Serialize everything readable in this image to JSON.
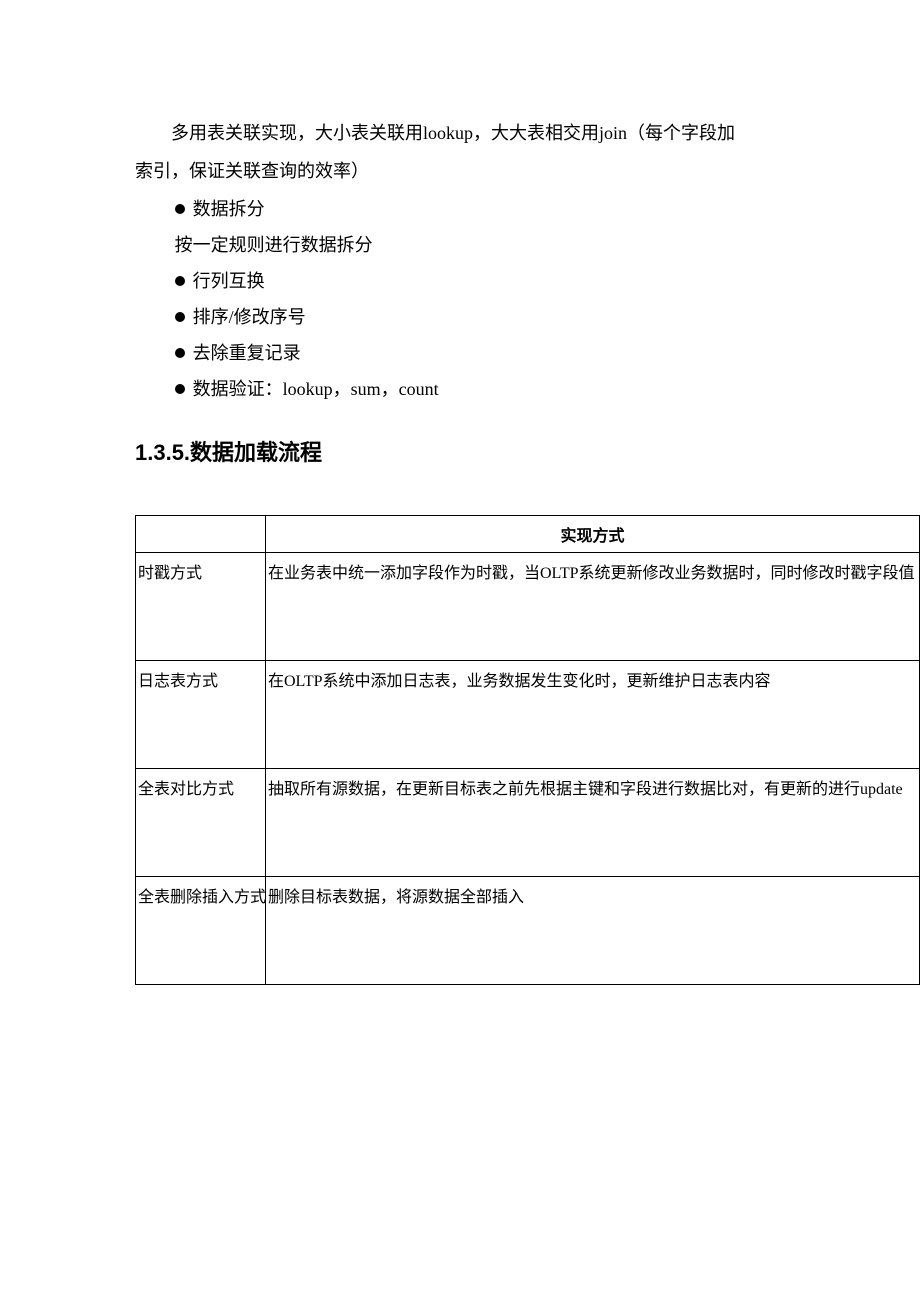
{
  "intro": {
    "line1": "多用表关联实现，大小表关联用lookup，大大表相交用join（每个字段加",
    "line2": "索引，保证关联查询的效率）"
  },
  "bullets": {
    "b1": "数据拆分",
    "b1_sub": "按一定规则进行数据拆分",
    "b2": "行列互换",
    "b3": "排序/修改序号",
    "b4": "去除重复记录",
    "b5": "数据验证：lookup，sum，count"
  },
  "heading": {
    "number": "1.3.5.",
    "title": "数据加载流程"
  },
  "table": {
    "header": {
      "col1": "",
      "col2": "实现方式"
    },
    "rows": [
      {
        "c1": "时戳方式",
        "c2": "在业务表中统一添加字段作为时戳，当OLTP系统更新修改业务数据时，同时修改时戳字段值"
      },
      {
        "c1": "日志表方式",
        "c2": "在OLTP系统中添加日志表，业务数据发生变化时，更新维护日志表内容"
      },
      {
        "c1": "全表对比方式",
        "c2": "抽取所有源数据，在更新目标表之前先根据主键和字段进行数据比对，有更新的进行update"
      },
      {
        "c1": "全表删除插入方式",
        "c2": "删除目标表数据，将源数据全部插入"
      }
    ]
  }
}
